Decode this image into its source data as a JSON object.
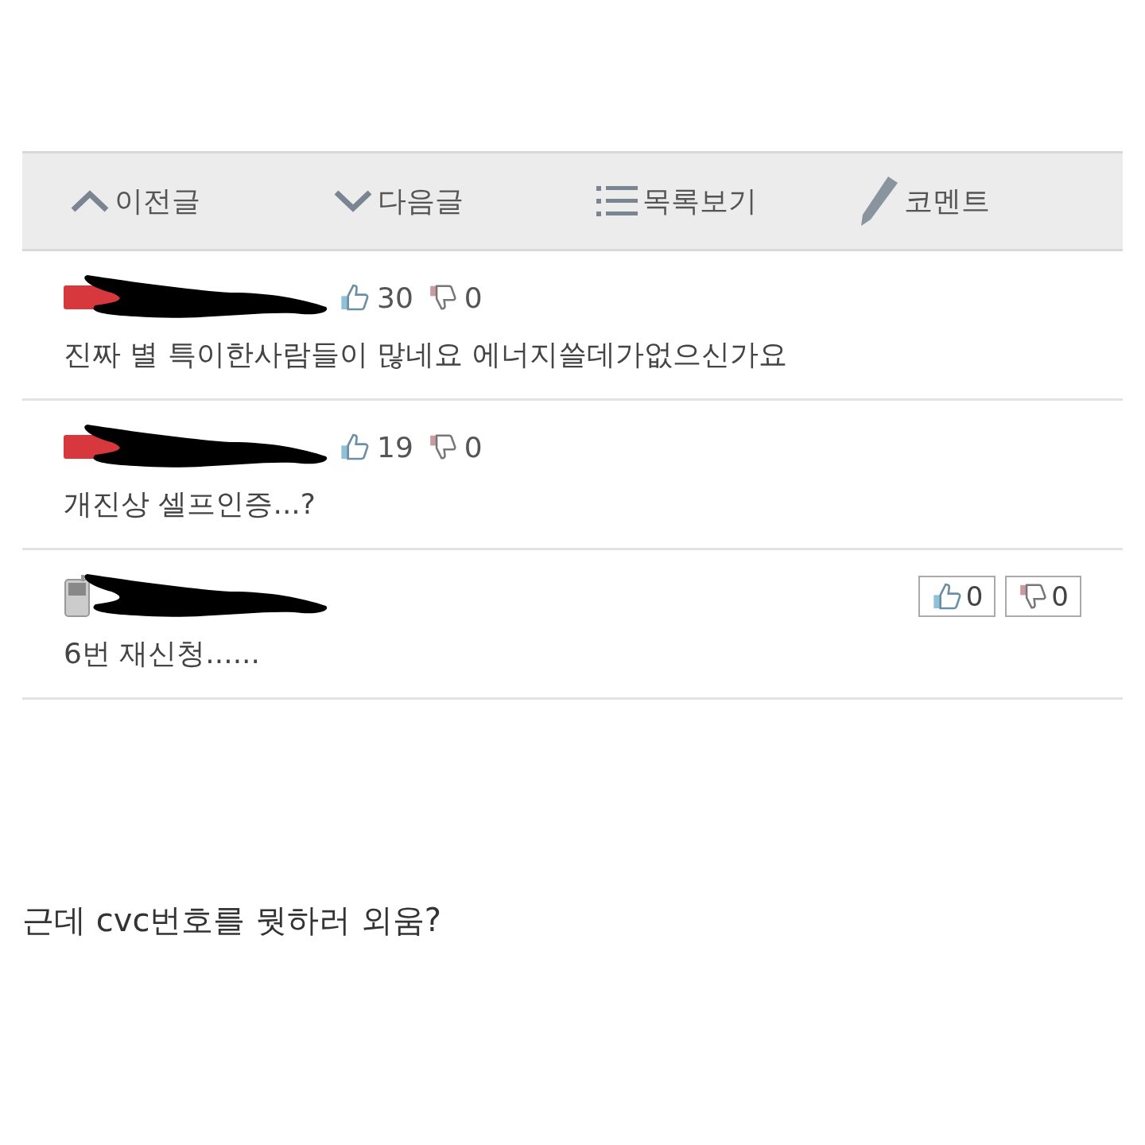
{
  "nav": [
    {
      "kind": "up",
      "label": "이전글"
    },
    {
      "kind": "down",
      "label": "다음글"
    },
    {
      "kind": "list",
      "label": "목록보기"
    },
    {
      "kind": "pencil",
      "label": "코멘트"
    }
  ],
  "comments": [
    {
      "kind": "hot",
      "up": "30",
      "down": "0",
      "text": "진짜 별 특이한사람들이 많네요 에너지쓸데가없으신가요"
    },
    {
      "kind": "hot",
      "up": "19",
      "down": "0",
      "text": "개진상 셀프인증...?"
    },
    {
      "kind": "mobile",
      "up": "0",
      "down": "0",
      "text": "6번 재신청......"
    }
  ],
  "caption": "근데 cvc번호를 뭣하러 외움?"
}
